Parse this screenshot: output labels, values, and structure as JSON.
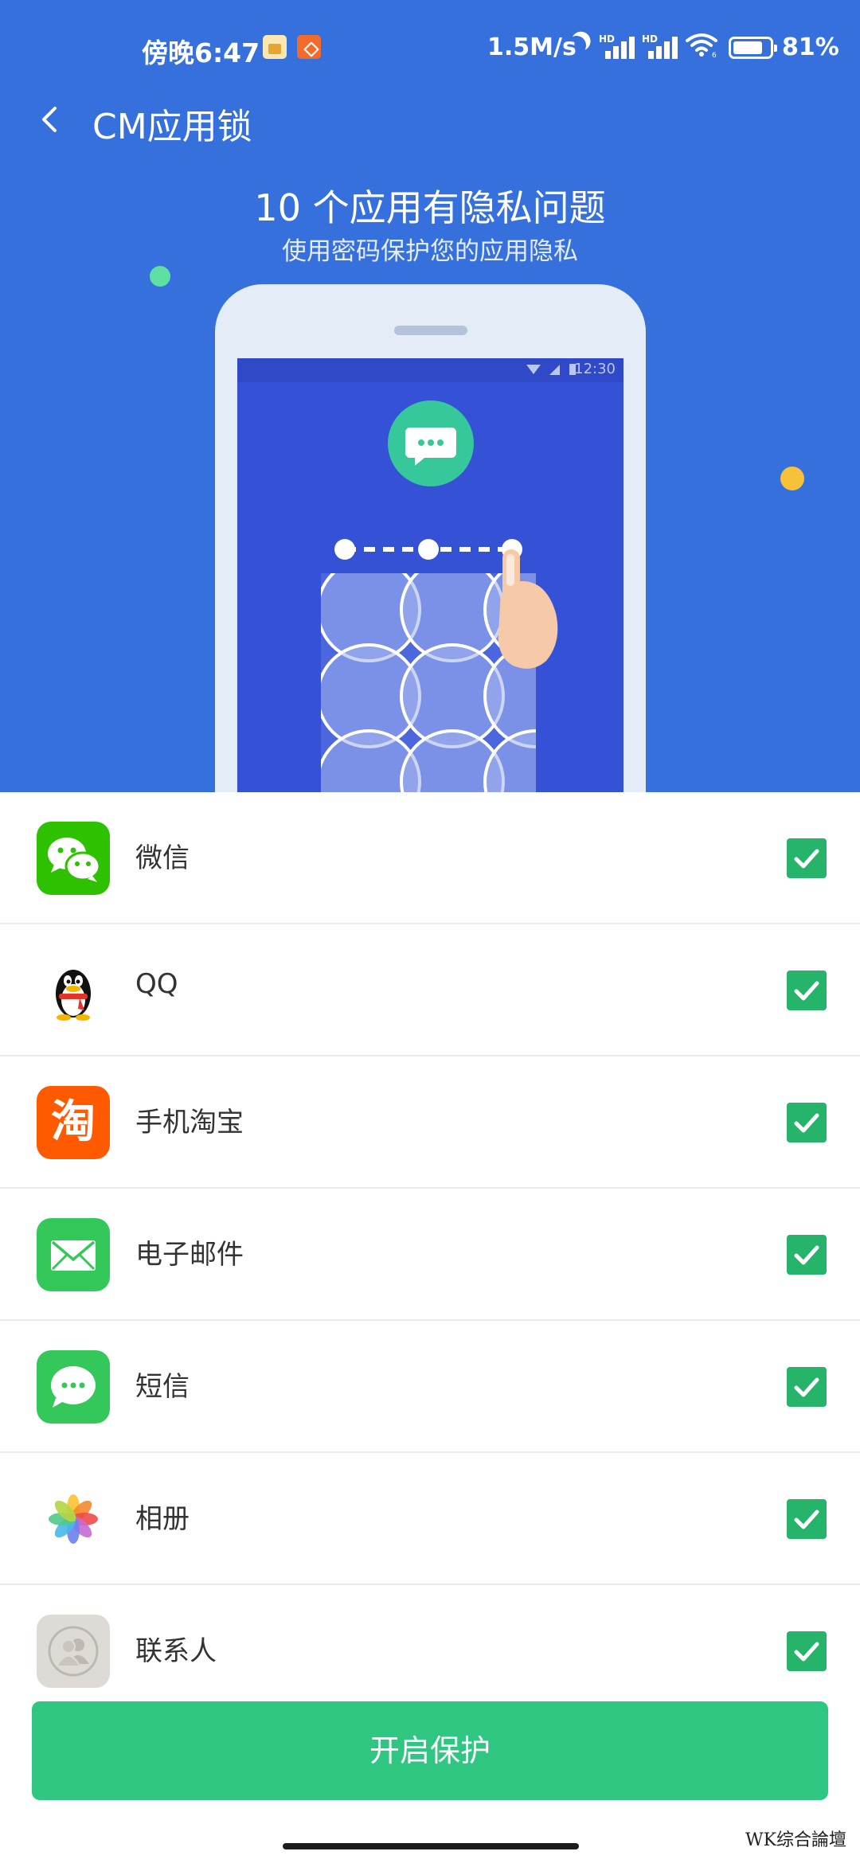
{
  "status_bar": {
    "time": "傍晚6:47",
    "network_speed": "1.5M/s",
    "signal1_label": "HD",
    "signal2_label": "HD",
    "wifi_sub": "6",
    "battery_level": 0.81,
    "battery_percent": "81%"
  },
  "header": {
    "title": "CM应用锁",
    "back_icon": "chevron-left-icon"
  },
  "hero": {
    "title": "10 个应用有隐私问题",
    "subtitle": "使用密码保护您的应用隐私",
    "phone_time": "12:30",
    "background_color": "#3670dc"
  },
  "apps": [
    {
      "name": "微信",
      "icon": "wechat-icon",
      "checked": true
    },
    {
      "name": "QQ",
      "icon": "qq-penguin-icon",
      "checked": true
    },
    {
      "name": "手机淘宝",
      "icon": "taobao-icon",
      "icon_text": "淘",
      "checked": true
    },
    {
      "name": "电子邮件",
      "icon": "mail-icon",
      "checked": true
    },
    {
      "name": "短信",
      "icon": "messages-icon",
      "checked": true
    },
    {
      "name": "相册",
      "icon": "photos-icon",
      "checked": true
    },
    {
      "name": "联系人",
      "icon": "contacts-icon",
      "checked": true
    }
  ],
  "actions": {
    "enable_label": "开启保护",
    "enable_color": "#2ec681",
    "check_color": "#26b36a"
  },
  "watermark": "WK综合論壇"
}
